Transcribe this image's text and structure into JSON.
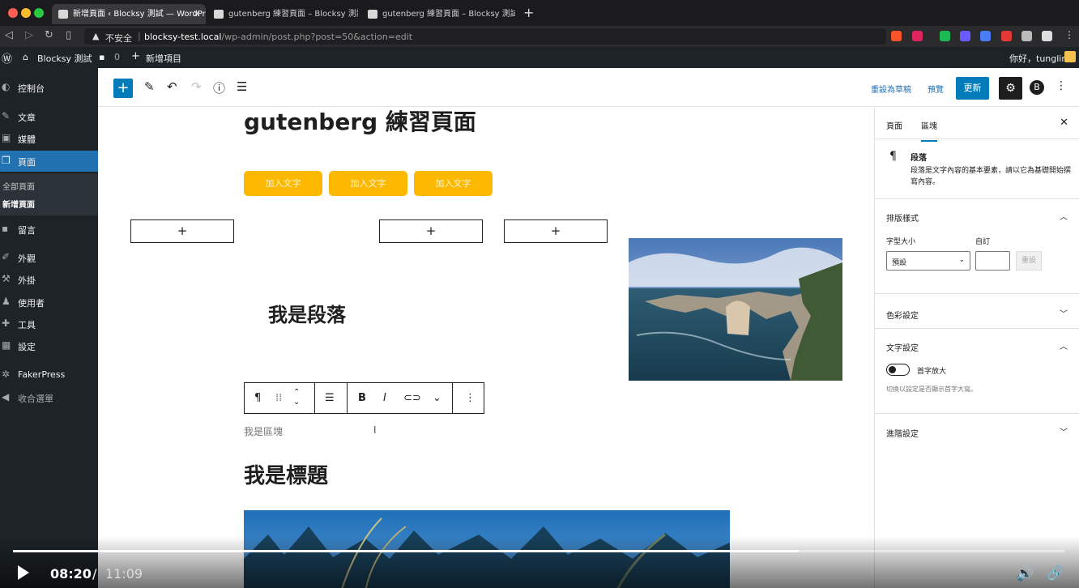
{
  "browser": {
    "tabs": [
      {
        "title": "新增頁面 ‹ Blocksy 測試 — WordPress"
      },
      {
        "title": "gutenberg 練習頁面 – Blocksy 測試"
      },
      {
        "title": "gutenberg 練習頁面 – Blocksy 測試"
      }
    ],
    "new_tab": "+",
    "security_label": "不安全",
    "url_host": "blocksy-test.local",
    "url_path": "/wp-admin/post.php?post=50&action=edit"
  },
  "adminbar": {
    "site_name": "Blocksy 測試",
    "comments_count": "0",
    "new_item": "新增項目",
    "greeting": "你好，tunglin"
  },
  "sidebar": {
    "items": [
      {
        "label": "控制台",
        "icon": "dashboard-icon"
      },
      {
        "label": "文章",
        "icon": "pin-icon"
      },
      {
        "label": "媒體",
        "icon": "media-icon"
      },
      {
        "label": "頁面",
        "icon": "pages-icon"
      },
      {
        "label": "留言",
        "icon": "comment-icon"
      },
      {
        "label": "外觀",
        "icon": "brush-icon"
      },
      {
        "label": "外掛",
        "icon": "plugin-icon"
      },
      {
        "label": "使用者",
        "icon": "user-icon"
      },
      {
        "label": "工具",
        "icon": "wrench-icon"
      },
      {
        "label": "設定",
        "icon": "settings-icon"
      },
      {
        "label": "FakerPress",
        "icon": "fakerpress-icon"
      },
      {
        "label": "收合選單",
        "icon": "collapse-icon"
      }
    ],
    "submenu": [
      "全部頁面",
      "新增頁面"
    ]
  },
  "toolbar": {
    "add_block": "+",
    "save_draft": "重設為草稿",
    "preview": "預覽",
    "update": "更新",
    "blocksy": "B"
  },
  "canvas": {
    "title": "gutenberg 練習頁面",
    "buttons": [
      "加入文字",
      "加入文字",
      "加入文字"
    ],
    "plus": "+",
    "paragraph_heading": "我是段落",
    "block_text": "我是區塊",
    "heading2": "我是標題"
  },
  "block_toolbar": {
    "paragraph": "¶",
    "bold": "B",
    "italic": "I"
  },
  "settings": {
    "tab_page": "頁面",
    "tab_block": "區塊",
    "block_title": "段落",
    "block_desc": "段落是文字內容的基本要素，請以它為基礎開始撰寫內容。",
    "typography_title": "排版樣式",
    "font_size_label": "字型大小",
    "custom_label": "自訂",
    "font_size_value": "預設",
    "reset": "重設",
    "color_title": "色彩設定",
    "text_title": "文字設定",
    "dropcap_label": "首字放大",
    "dropcap_help": "切換以設定是否顯示首字大寫。",
    "advanced_title": "進階設定"
  },
  "video": {
    "current_time": "08:20",
    "separator": "/",
    "total_time": "11:09",
    "progress": 0.747
  },
  "colors": {
    "accent": "#007cba",
    "yellow": "#fcb900",
    "wp_dark": "#1d2327"
  }
}
